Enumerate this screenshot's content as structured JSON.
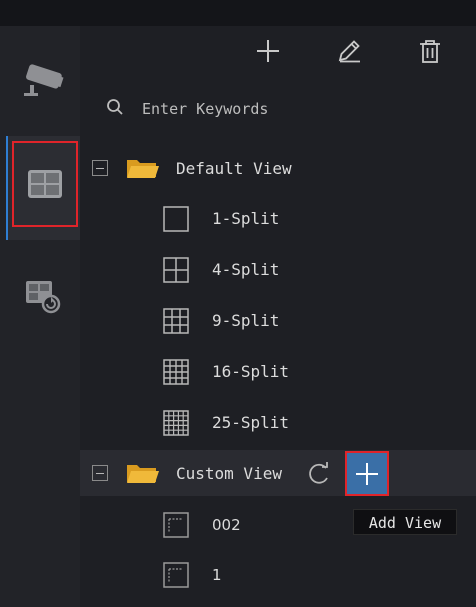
{
  "sidebar": {
    "items": [
      {
        "icon": "camera-icon"
      },
      {
        "icon": "grid-view-icon",
        "active": true
      },
      {
        "icon": "playback-icon"
      }
    ]
  },
  "toolbar": {
    "add_icon": "plus-icon",
    "edit_icon": "pencil-icon",
    "delete_icon": "trash-icon"
  },
  "search": {
    "placeholder": "Enter Keywords"
  },
  "tree": {
    "default_view": {
      "label": "Default View",
      "items": [
        {
          "label": "1-Split"
        },
        {
          "label": "4-Split"
        },
        {
          "label": "9-Split"
        },
        {
          "label": "16-Split"
        },
        {
          "label": "25-Split"
        }
      ]
    },
    "custom_view": {
      "label": "Custom View",
      "add_tooltip": "Add View",
      "items": [
        {
          "label": "002"
        },
        {
          "label": "1"
        }
      ]
    }
  },
  "colors": {
    "accent": "#2f7fd4",
    "highlight": "#e0242a",
    "folder": "#f0b93a",
    "add_button_bg": "#3a6fa7"
  }
}
